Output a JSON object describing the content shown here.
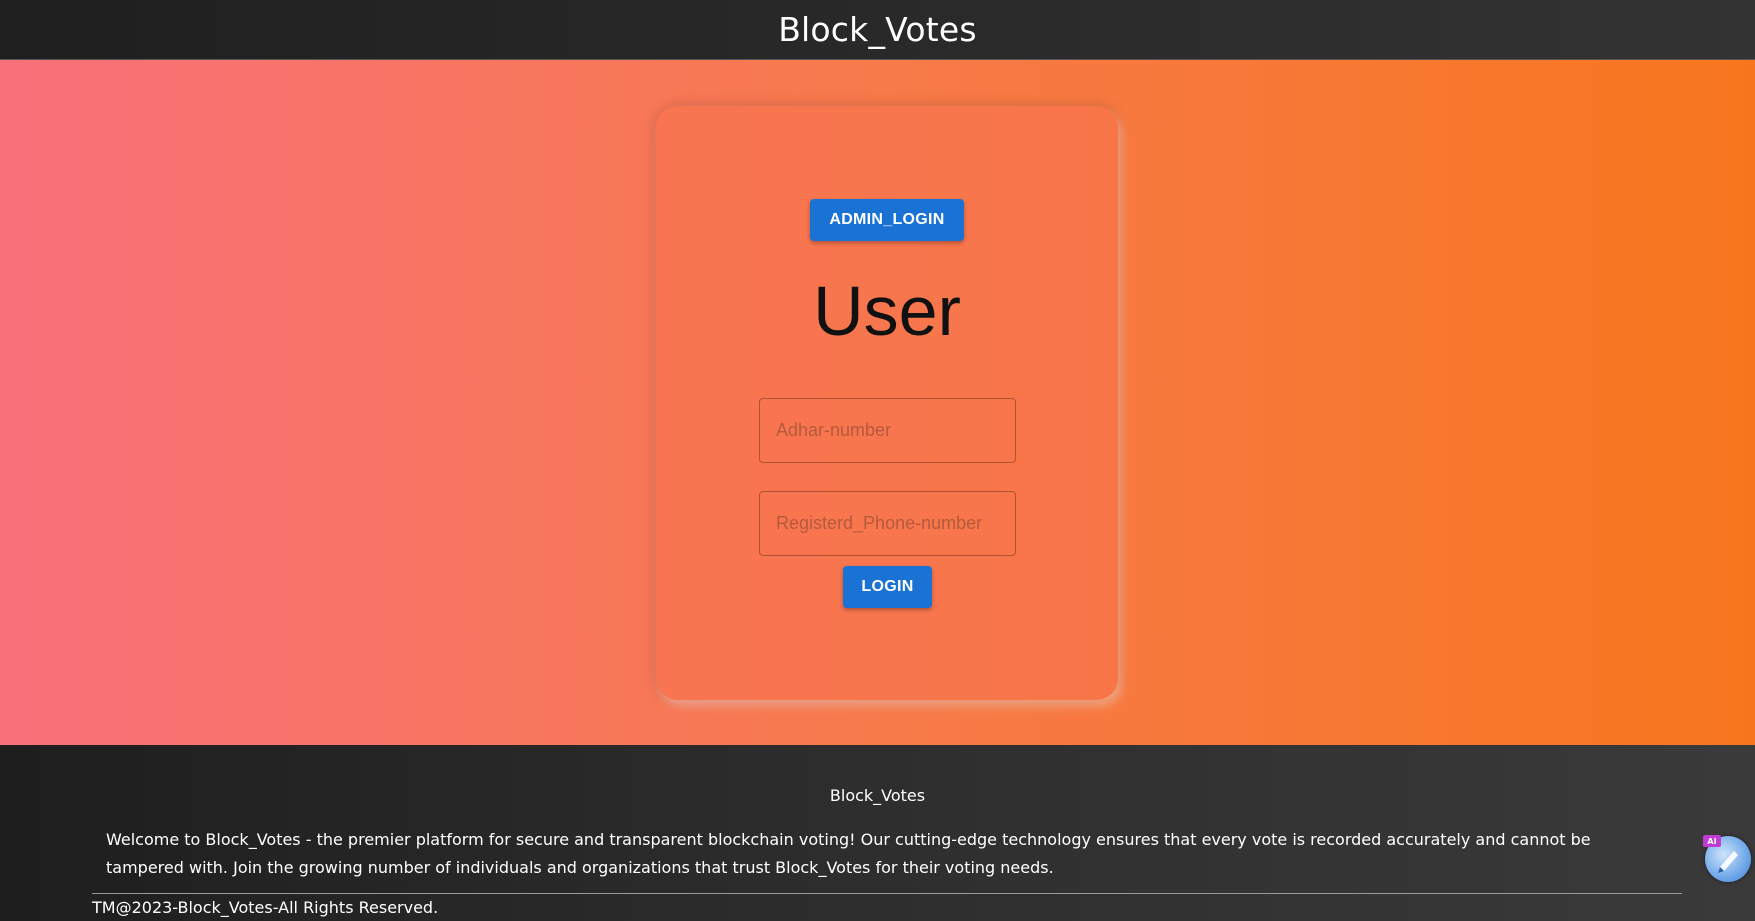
{
  "header": {
    "title": "Block_Votes"
  },
  "login_card": {
    "admin_button_label": "ADMIN_LOGIN",
    "title": "User",
    "adhar_placeholder": "Adhar-number",
    "phone_placeholder": "Registerd_Phone-number",
    "login_button_label": "LOGIN"
  },
  "footer": {
    "brand": "Block_Votes",
    "description": "Welcome to Block_Votes - the premier platform for secure and transparent blockchain voting! Our cutting-edge technology ensures that every vote is recorded accurately and cannot be tampered with. Join the growing number of individuals and organizations that trust Block_Votes for their voting needs.",
    "copyright": "TM@2023-Block_Votes-All Rights Reserved."
  },
  "assistant_widget": {
    "badge": "AI",
    "icon": "pen-icon"
  },
  "colors": {
    "accent": "#1a73d4",
    "hero_gradient_start": "#f8707a",
    "hero_gradient_end": "#f7761d",
    "header_bg": "#1f1f1f",
    "footer_bg": "#2b2b2b"
  }
}
